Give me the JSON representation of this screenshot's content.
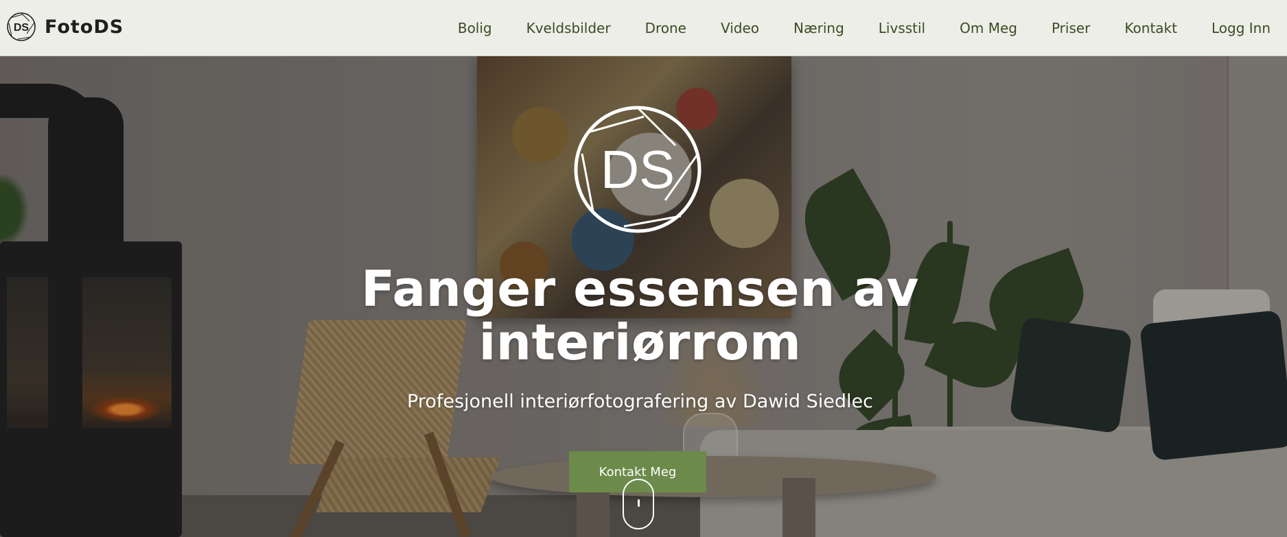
{
  "brand": {
    "name": "FotoDS",
    "logo_text": "DS"
  },
  "nav": {
    "items": [
      {
        "label": "Bolig"
      },
      {
        "label": "Kveldsbilder"
      },
      {
        "label": "Drone"
      },
      {
        "label": "Video"
      },
      {
        "label": "Næring"
      },
      {
        "label": "Livsstil"
      },
      {
        "label": "Om Meg"
      },
      {
        "label": "Priser"
      },
      {
        "label": "Kontakt"
      },
      {
        "label": "Logg Inn"
      }
    ]
  },
  "hero": {
    "logo_text": "DS",
    "title_line1": "Fanger essensen av",
    "title_line2": "interiørrom",
    "subtitle": "Profesjonell interiørfotografering av Dawid Siedlec",
    "cta_label": "Kontakt Meg"
  },
  "colors": {
    "header_bg": "#eceee7",
    "nav_text": "#3d4a24",
    "cta_bg": "#6c8a4a",
    "hero_text": "#ffffff"
  },
  "icons": {
    "brand_logo": "ds-aperture-logo-icon",
    "hero_logo": "ds-aperture-logo-icon",
    "scroll": "mouse-scroll-icon"
  }
}
